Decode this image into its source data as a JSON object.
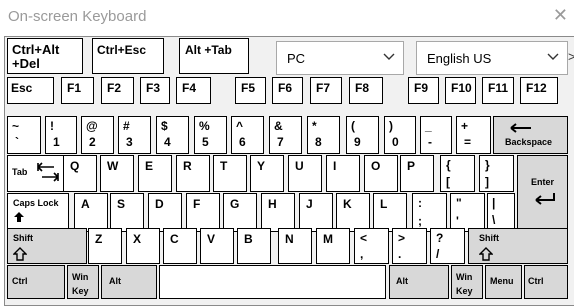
{
  "window": {
    "title": "On-screen Keyboard",
    "close_glyph": "✕"
  },
  "top": {
    "ctrl_alt_del": "Ctrl+Alt\n+Del",
    "ctrl_esc": "Ctrl+Esc",
    "alt_tab": "Alt +Tab",
    "layout_select": "PC",
    "language_select": "English US",
    "more_glyph": ">"
  },
  "frow": [
    "Esc",
    "F1",
    "F2",
    "F3",
    "F4",
    "F5",
    "F6",
    "F7",
    "F8",
    "F9",
    "F10",
    "F11",
    "F12"
  ],
  "num": {
    "top": [
      "~",
      "!",
      "@",
      "#",
      "$",
      "%",
      "^",
      "&",
      "*",
      "(",
      ")",
      "_",
      "+"
    ],
    "bottom": [
      "`",
      "1",
      "2",
      "3",
      "4",
      "5",
      "6",
      "7",
      "8",
      "9",
      "0",
      "-",
      "="
    ],
    "backspace": "Backspace"
  },
  "qrow": {
    "tab": "Tab",
    "letters": [
      "Q",
      "W",
      "E",
      "R",
      "T",
      "Y",
      "U",
      "I",
      "O",
      "P"
    ],
    "br_top": [
      "{",
      "}"
    ],
    "br_bottom": [
      "[",
      "]"
    ],
    "enter": "Enter"
  },
  "arow": {
    "caps": "Caps Lock",
    "letters": [
      "A",
      "S",
      "D",
      "F",
      "G",
      "H",
      "J",
      "K",
      "L"
    ],
    "p_top": [
      ":",
      "\""
    ],
    "p_bottom": [
      ";",
      "'"
    ],
    "pipe_top": "|",
    "pipe_bottom": "\\"
  },
  "zrow": {
    "shift": "Shift",
    "letters": [
      "Z",
      "X",
      "C",
      "V",
      "B",
      "N",
      "M"
    ],
    "p_top": [
      "<",
      ">",
      "?"
    ],
    "p_bottom": [
      ",",
      ".",
      "/"
    ]
  },
  "brow": {
    "ctrl_left": "Ctrl",
    "win_left": "Win\nKey",
    "alt_left": "Alt",
    "alt_right": "Alt",
    "win_right": "Win\nKey",
    "menu": "Menu",
    "ctrl_right": "Ctrl"
  }
}
